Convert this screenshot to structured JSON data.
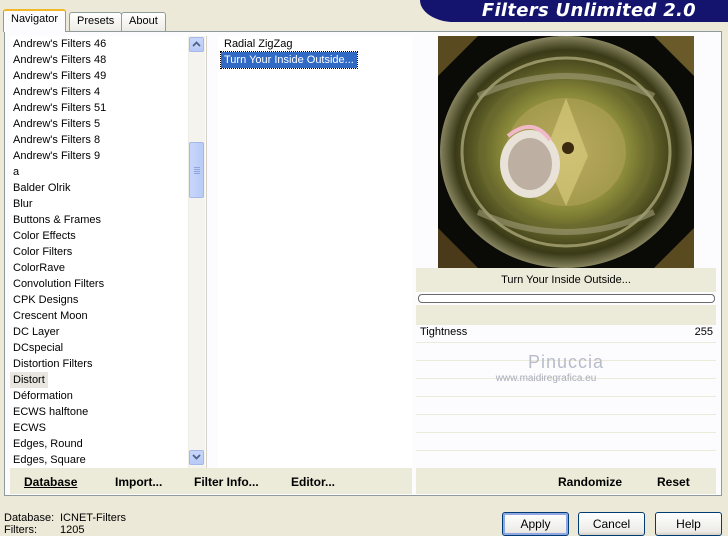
{
  "app": {
    "title": "Filters Unlimited 2.0"
  },
  "tabs": [
    {
      "label": "Navigator",
      "active": true
    },
    {
      "label": "Presets",
      "active": false
    },
    {
      "label": "About",
      "active": false
    }
  ],
  "categories": [
    "Andrew's Filters 46",
    "Andrew's Filters 48",
    "Andrew's Filters 49",
    "Andrew's Filters 4",
    "Andrew's Filters 51",
    "Andrew's Filters 5",
    "Andrew's Filters 8",
    "Andrew's Filters 9",
    "a",
    "Balder Olrik",
    "Blur",
    "Buttons & Frames",
    "Color Effects",
    "Color Filters",
    "ColorRave",
    "Convolution Filters",
    "CPK Designs",
    "Crescent Moon",
    "DC Layer",
    "DCspecial",
    "Distortion Filters",
    "Distort",
    "Déformation",
    "ECWS halftone",
    "ECWS",
    "Edges, Round",
    "Edges, Square"
  ],
  "selected_category": "Distort",
  "filters": [
    "Radial ZigZag",
    "Turn Your Inside Outside..."
  ],
  "selected_filter": "Turn Your Inside Outside...",
  "preview": {
    "filter_name": "Turn Your Inside Outside..."
  },
  "params": [
    {
      "label": "Tightness",
      "value": "255"
    }
  ],
  "watermark": {
    "name": "Pinuccia",
    "url": "www.maidiregrafica.eu"
  },
  "bottom_bar": {
    "database": "Database",
    "import": "Import...",
    "filter_info": "Filter Info...",
    "editor": "Editor...",
    "randomize": "Randomize",
    "reset": "Reset"
  },
  "status": {
    "database_label": "Database:",
    "database_value": "ICNET-Filters",
    "filters_label": "Filters:",
    "filters_value": "1205"
  },
  "buttons": {
    "apply": "Apply",
    "cancel": "Cancel",
    "help": "Help"
  },
  "colors": {
    "banner": "#14136e",
    "highlight": "#316ac5",
    "tab_accent": "#f4b72b"
  }
}
